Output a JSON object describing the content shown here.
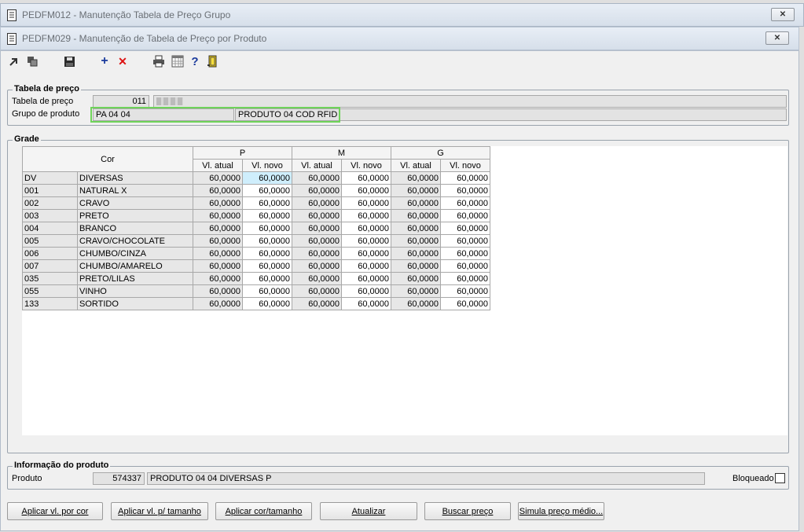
{
  "windows": {
    "outer_title": "PEDFM012 - Manutenção Tabela de Preço Grupo",
    "inner_title": "PEDFM029 - Manutenção de Tabela de Preço por Produto"
  },
  "toolbar": {
    "icons": [
      "arrow-icon",
      "copy-icon",
      "save-icon",
      "add-icon",
      "delete-icon",
      "print-icon",
      "calendar-grid-icon",
      "help-icon",
      "exit-door-icon"
    ]
  },
  "tabela_preco": {
    "title": "Tabela de preço",
    "tabela_label": "Tabela de preço",
    "tabela_value": "011",
    "grupo_label": "Grupo de produto",
    "grupo_code": "PA 04 04",
    "grupo_desc": "PRODUTO 04 COD RFID"
  },
  "grade": {
    "title": "Grade",
    "cor_header": "Cor",
    "sizes": [
      "P",
      "M",
      "G"
    ],
    "sub_headers": [
      "Vl. atual",
      "Vl. novo"
    ],
    "rows": [
      {
        "code": "DV",
        "name": "DIVERSAS",
        "values": [
          "60,0000",
          "60,0000",
          "60,0000",
          "60,0000",
          "60,0000",
          "60,0000"
        ]
      },
      {
        "code": "001",
        "name": "NATURAL X",
        "values": [
          "60,0000",
          "60,0000",
          "60,0000",
          "60,0000",
          "60,0000",
          "60,0000"
        ]
      },
      {
        "code": "002",
        "name": "CRAVO",
        "values": [
          "60,0000",
          "60,0000",
          "60,0000",
          "60,0000",
          "60,0000",
          "60,0000"
        ]
      },
      {
        "code": "003",
        "name": "PRETO",
        "values": [
          "60,0000",
          "60,0000",
          "60,0000",
          "60,0000",
          "60,0000",
          "60,0000"
        ]
      },
      {
        "code": "004",
        "name": "BRANCO",
        "values": [
          "60,0000",
          "60,0000",
          "60,0000",
          "60,0000",
          "60,0000",
          "60,0000"
        ]
      },
      {
        "code": "005",
        "name": "CRAVO/CHOCOLATE",
        "values": [
          "60,0000",
          "60,0000",
          "60,0000",
          "60,0000",
          "60,0000",
          "60,0000"
        ]
      },
      {
        "code": "006",
        "name": "CHUMBO/CINZA",
        "values": [
          "60,0000",
          "60,0000",
          "60,0000",
          "60,0000",
          "60,0000",
          "60,0000"
        ]
      },
      {
        "code": "007",
        "name": "CHUMBO/AMARELO",
        "values": [
          "60,0000",
          "60,0000",
          "60,0000",
          "60,0000",
          "60,0000",
          "60,0000"
        ]
      },
      {
        "code": "035",
        "name": "PRETO/LILAS",
        "values": [
          "60,0000",
          "60,0000",
          "60,0000",
          "60,0000",
          "60,0000",
          "60,0000"
        ]
      },
      {
        "code": "055",
        "name": "VINHO",
        "values": [
          "60,0000",
          "60,0000",
          "60,0000",
          "60,0000",
          "60,0000",
          "60,0000"
        ]
      },
      {
        "code": "133",
        "name": "SORTIDO",
        "values": [
          "60,0000",
          "60,0000",
          "60,0000",
          "60,0000",
          "60,0000",
          "60,0000"
        ]
      }
    ]
  },
  "produto_info": {
    "title": "Informação do produto",
    "produto_label": "Produto",
    "produto_code": "574337",
    "produto_desc": "PRODUTO 04 04 DIVERSAS P",
    "bloqueado_label": "Bloqueado"
  },
  "buttons": {
    "aplicar_cor": "Aplicar vl. por cor",
    "aplicar_tamanho": "Aplicar vl. p/ tamanho",
    "aplicar_cor_tamanho": "Aplicar cor/tamanho",
    "atualizar": "Atualizar",
    "buscar_preco": "Buscar preço",
    "simula": "Simula preço médio..."
  },
  "colors": {
    "highlight": "#6fd35a",
    "selected_cell": "#cfeefc"
  }
}
